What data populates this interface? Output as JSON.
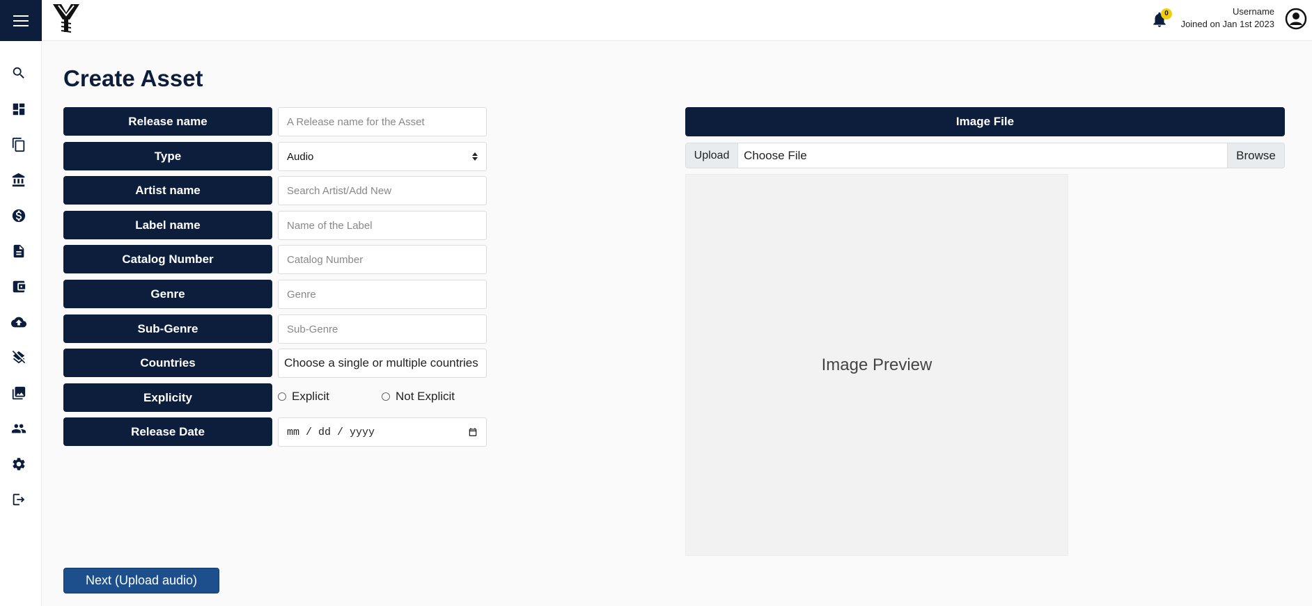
{
  "header": {
    "menu_icon": "hamburger-menu-icon",
    "logo_icon": "brand-logo-icon",
    "notification_count": "0",
    "username": "Username",
    "joined": "Joined on Jan 1st 2023"
  },
  "sidebar": {
    "items": [
      {
        "icon": "search-icon"
      },
      {
        "icon": "dashboard-icon"
      },
      {
        "icon": "documents-icon"
      },
      {
        "icon": "bank-icon"
      },
      {
        "icon": "dollar-icon"
      },
      {
        "icon": "receipt-icon"
      },
      {
        "icon": "wallet-icon"
      },
      {
        "icon": "cloud-upload-icon"
      },
      {
        "icon": "layers-off-icon"
      },
      {
        "icon": "image-gallery-icon"
      },
      {
        "icon": "users-icon"
      },
      {
        "icon": "settings-icon"
      },
      {
        "icon": "logout-icon"
      }
    ]
  },
  "page": {
    "title": "Create Asset"
  },
  "form": {
    "release_name": {
      "label": "Release name",
      "placeholder": "A Release name for the Asset"
    },
    "type": {
      "label": "Type",
      "value": "Audio"
    },
    "artist_name": {
      "label": "Artist name",
      "placeholder": "Search Artist/Add New"
    },
    "label_name": {
      "label": "Label name",
      "placeholder": "Name of the Label"
    },
    "catalog_number": {
      "label": "Catalog Number",
      "placeholder": "Catalog Number"
    },
    "genre": {
      "label": "Genre",
      "placeholder": "Genre"
    },
    "sub_genre": {
      "label": "Sub-Genre",
      "placeholder": "Sub-Genre"
    },
    "countries": {
      "label": "Countries",
      "placeholder": "Choose a single or multiple countries"
    },
    "explicity": {
      "label": "Explicity",
      "option_explicit": "Explicit",
      "option_not_explicit": "Not Explicit"
    },
    "release_date": {
      "label": "Release Date",
      "placeholder": "mm / dd / yyyy"
    },
    "next_button": "Next (Upload audio)"
  },
  "image_panel": {
    "header": "Image File",
    "upload_tag": "Upload",
    "choose_file": "Choose File",
    "browse": "Browse",
    "preview": "Image Preview"
  },
  "colors": {
    "primary": "#0c1e3c",
    "button": "#1c4f8c",
    "badge": "#f2cc0c"
  }
}
